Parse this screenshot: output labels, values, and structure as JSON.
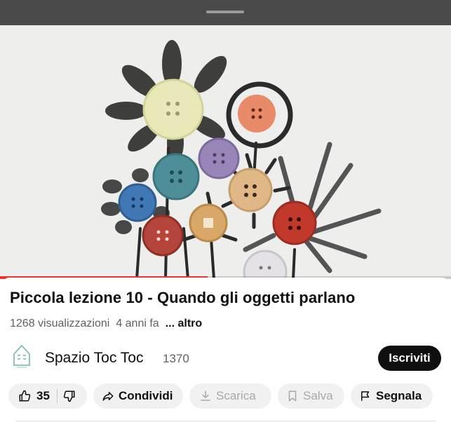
{
  "video": {
    "title": "Piccola lezione 10 - Quando gli oggetti parlano",
    "views": "1268 visualizzazioni",
    "age": "4 anni fa",
    "more_label": "... altro",
    "progress_fraction": 0.46
  },
  "channel": {
    "name": "Spazio Toc Toc",
    "subscribers": "1370",
    "subscribe_label": "Iscriviti"
  },
  "actions": {
    "like_count": "35",
    "share_label": "Condividi",
    "download_label": "Scarica",
    "save_label": "Salva",
    "report_label": "Segnala"
  },
  "colors": {
    "progress": "#e53935",
    "subscribe_bg": "#0f0f0f"
  }
}
